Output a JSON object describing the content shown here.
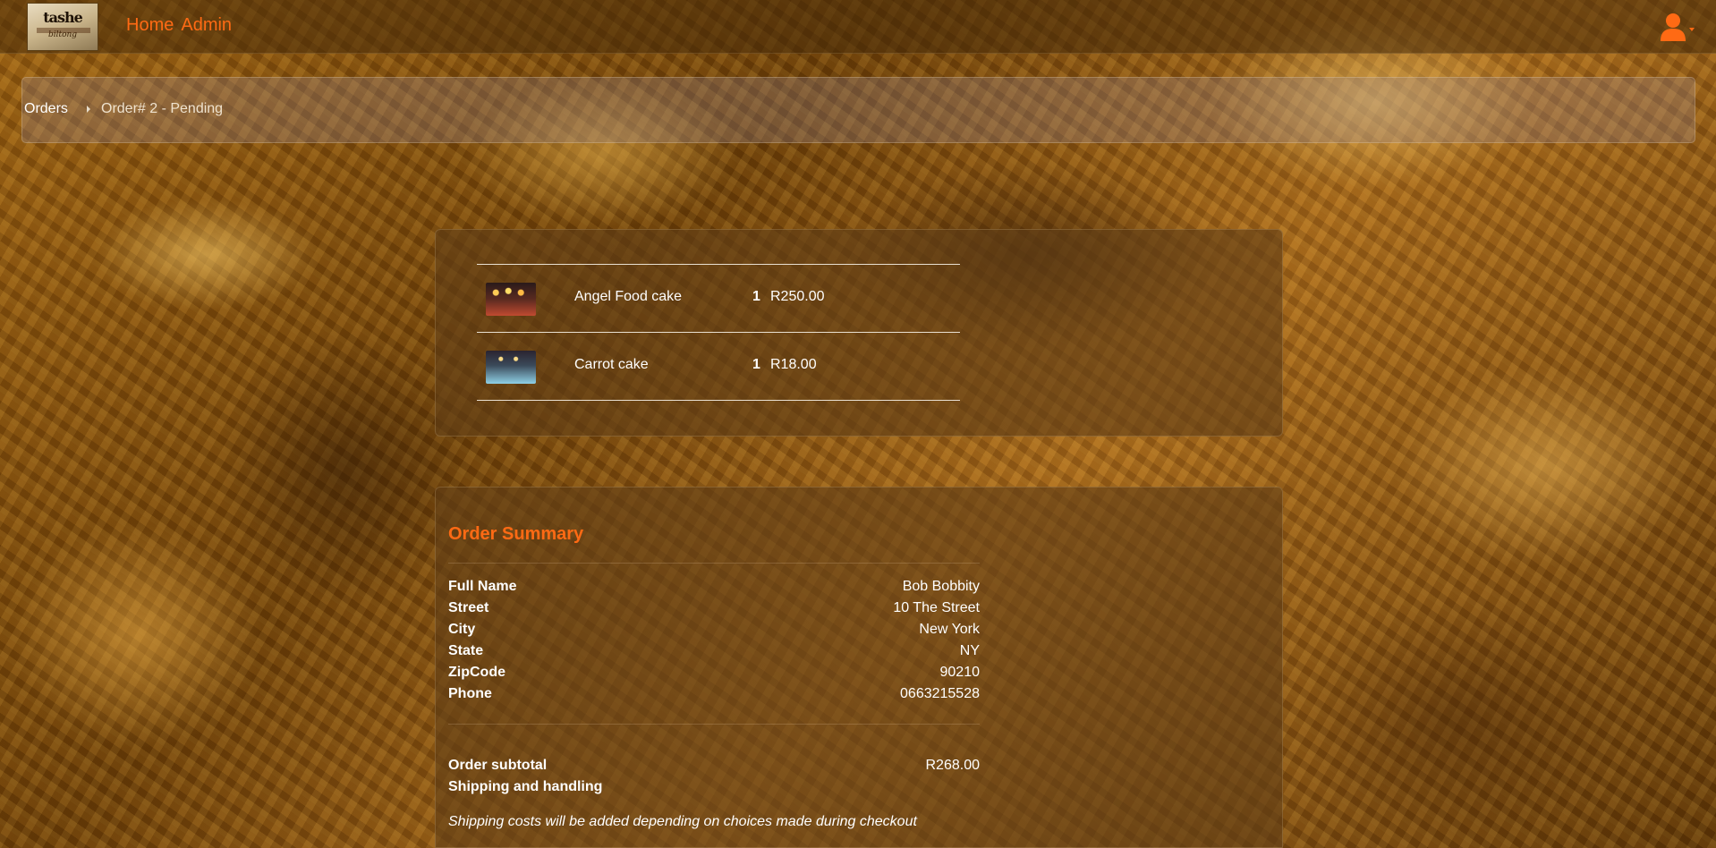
{
  "navbar": {
    "logo": {
      "main": "tashe",
      "sub": "biltong"
    },
    "links": [
      {
        "label": "Home"
      },
      {
        "label": "Admin"
      }
    ],
    "user_icon": "user-icon",
    "accent_color": "#ff6a14"
  },
  "breadcrumb": {
    "orders": "Orders",
    "separator_icon": "chevron-right-icon",
    "current": "Order# 2 - Pending"
  },
  "items": [
    {
      "name": "Angel Food cake",
      "quantity": "1",
      "price": "R250.00",
      "image_icon": "cake-thumbnail"
    },
    {
      "name": "Carrot cake",
      "quantity": "1",
      "price": "R18.00",
      "image_icon": "cake-thumbnail"
    }
  ],
  "summary": {
    "title": "Order Summary",
    "fields": [
      {
        "label": "Full Name",
        "value": "Bob Bobbity"
      },
      {
        "label": "Street",
        "value": "10 The Street"
      },
      {
        "label": "City",
        "value": "New York"
      },
      {
        "label": "State",
        "value": "NY"
      },
      {
        "label": "ZipCode",
        "value": "90210"
      },
      {
        "label": "Phone",
        "value": "0663215528"
      }
    ],
    "subtotal_label": "Order subtotal",
    "subtotal_value": "R268.00",
    "shipping_label": "Shipping and handling",
    "shipping_note": "Shipping costs will be added depending on choices made during checkout"
  }
}
